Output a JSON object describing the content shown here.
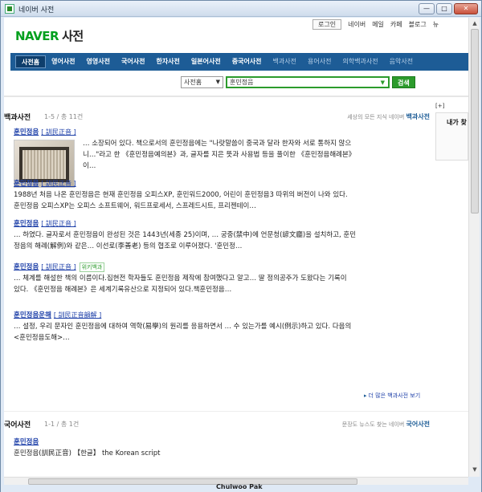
{
  "window": {
    "title": "네이버 사전",
    "buttons": [
      "—",
      "□",
      "✕"
    ]
  },
  "logo": {
    "brand": "NAVER",
    "service": "사전"
  },
  "gnb": {
    "login": "로그인",
    "links": [
      "네이버",
      "메일",
      "카페",
      "블로그",
      "뉴"
    ]
  },
  "categories": [
    {
      "label": "사전홈",
      "active": true,
      "light": false
    },
    {
      "label": "영어사전",
      "active": false,
      "light": false
    },
    {
      "label": "영영사전",
      "active": false,
      "light": false
    },
    {
      "label": "국어사전",
      "active": false,
      "light": false
    },
    {
      "label": "한자사전",
      "active": false,
      "light": false
    },
    {
      "label": "일본어사전",
      "active": false,
      "light": false
    },
    {
      "label": "중국어사전",
      "active": false,
      "light": false
    },
    {
      "label": "백과사전",
      "active": false,
      "light": true
    },
    {
      "label": "용어사전",
      "active": false,
      "light": true
    },
    {
      "label": "의학백과사전",
      "active": false,
      "light": true
    },
    {
      "label": "음악사전",
      "active": false,
      "light": true
    }
  ],
  "search": {
    "select": "사전홈",
    "query": "훈민정음",
    "button": "검색"
  },
  "encyclopedia": {
    "title": "백과사전",
    "count": "1-5 / 총 11건",
    "tag_text": "세상의 모든 지식 네이버",
    "tag_link": "백과사전",
    "more": "더 많은 백과사전 보기",
    "results": [
      {
        "title": "훈민정음",
        "hanja": "[ 訓民正音 ]",
        "wiki": "",
        "lines": [
          "… 소장되어 있다. 책으로서의 훈민정음에는 \"나랏말씀이 중국과 달라 한자와 서로 통하지 않으",
          "니…\"라고 한 《훈민정음예의본》과, 글자를 지은 뜻과 사용법 등을 풀이한 《훈민정음해례본》",
          "이…"
        ]
      },
      {
        "title": "훈민정음",
        "hanja": "[ 訓民正音 ]",
        "wiki": "",
        "lines": [
          "1988년 처음 나온 훈민정음은 현재 훈민정음 오피스XP, 훈민워드2000, 어린이 훈민정음3 따위의 버전이 나와 있다.",
          "훈민정음 오피스XP는 오피스 소프트웨어, 워드프로세서, 스프레드시트, 프리젠테이…"
        ]
      },
      {
        "title": "훈민정음",
        "hanja": "[ 訓民正音 ]",
        "wiki": "",
        "lines": [
          "… 하였다. 글자로서 훈민정음이 완성된 것은 1443년(세종 25)이며, … 궁중(禁中)에 언문청(諺文廳)을 설치하고, 훈민",
          "정음의 해례(解例)와 같은… 이선로(李善老) 등의 협조로 이루어졌다. '훈민정…"
        ]
      },
      {
        "title": "훈민정음",
        "hanja": "[ 訓民正音 ]",
        "wiki": "위키백과",
        "lines": [
          "… 체계를 해설한 책의 이름이다.집현전 학자들도 훈민정음 제작에 참여했다고 알고… 딸 정의공주가 도왔다는 기록이",
          "있다. 《훈민정음 해례본》은 세계기록유산으로 지정되어 있다.책훈민정음…"
        ]
      },
      {
        "title": "훈민정음운해",
        "hanja": "[ 訓民正音韻解 ]",
        "wiki": "",
        "lines": [
          "… 설정, 우리 문자인 훈민정음에 대하여 역학(易學)의 원리를 응용하면서 … 수 있는가를 예시(例示)하고 있다. 다음의",
          "<훈민정음도해>…"
        ]
      }
    ]
  },
  "korean": {
    "title": "국어사전",
    "count": "1-1 / 총 1건",
    "tag_text": "문장도 뉴스도 찾는 네이버",
    "tag_link": "국어사전",
    "results": [
      {
        "title": "훈민정음",
        "lines": [
          "훈민정음(訓民正音) 【한글】 the Korean script"
        ]
      }
    ]
  },
  "side": {
    "toggle": "[+]",
    "label": "내가 찾"
  },
  "statusbar": "Chulwoo Pak"
}
